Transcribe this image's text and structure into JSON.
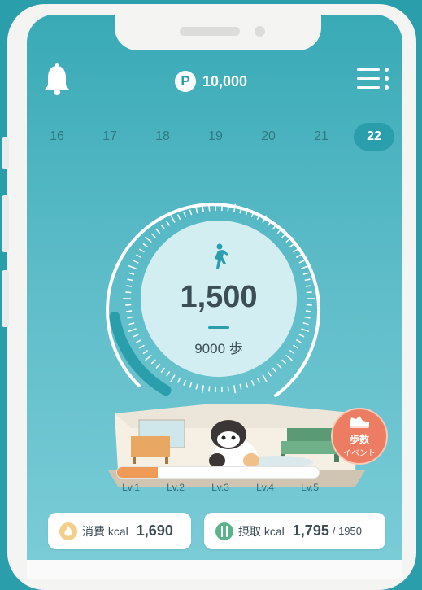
{
  "header": {
    "points": "10,000",
    "points_badge": "P"
  },
  "dates": [
    {
      "label": "16",
      "active": false
    },
    {
      "label": "17",
      "active": false
    },
    {
      "label": "18",
      "active": false
    },
    {
      "label": "19",
      "active": false
    },
    {
      "label": "20",
      "active": false
    },
    {
      "label": "21",
      "active": false
    },
    {
      "label": "22",
      "active": true
    }
  ],
  "steps": {
    "count": "1,500",
    "goal": "9000 歩",
    "progress": 0.167
  },
  "levels": {
    "labels": [
      "Lv.1",
      "Lv.2",
      "Lv.3",
      "Lv.4",
      "Lv.5"
    ],
    "progress": 0.2
  },
  "event": {
    "line1": "歩数",
    "line2": "イベント"
  },
  "cards": {
    "burned": {
      "label": "消費 kcal",
      "value": "1,690"
    },
    "intake": {
      "label": "摂取 kcal",
      "value": "1,795",
      "target": "/ 1950"
    }
  },
  "colors": {
    "accent": "#2a9eab",
    "bar_fill": "#ef9a56",
    "event": "#ec7d63"
  },
  "icons": {
    "bell": "bell-icon",
    "menu": "menu-icon",
    "walk": "walking-person-icon"
  }
}
